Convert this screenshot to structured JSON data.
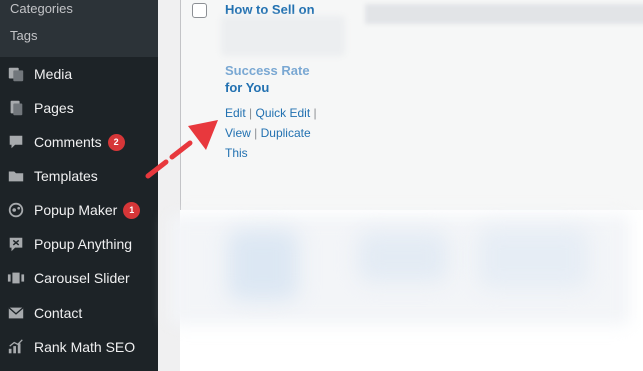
{
  "sidebar": {
    "submenu": [
      "Categories",
      "Tags"
    ],
    "items": [
      {
        "label": "Media",
        "icon": "media-icon"
      },
      {
        "label": "Pages",
        "icon": "pages-icon"
      },
      {
        "label": "Comments",
        "icon": "comments-icon",
        "badge": "2"
      },
      {
        "label": "Templates",
        "icon": "folder-icon"
      },
      {
        "label": "Popup Maker",
        "icon": "popup-maker-icon",
        "badge": "1"
      },
      {
        "label": "Popup Anything",
        "icon": "popup-anything-icon"
      },
      {
        "label": "Carousel Slider",
        "icon": "slider-icon"
      },
      {
        "label": "Contact",
        "icon": "mail-icon"
      },
      {
        "label": "Rank Math SEO",
        "icon": "chart-icon"
      }
    ]
  },
  "post": {
    "title_start": "How to Sell on",
    "title_end_faded": "Success Rate",
    "title_end": "for You",
    "actions": {
      "edit": "Edit",
      "quick_edit": "Quick Edit",
      "view": "View",
      "duplicate": "Duplicate This",
      "separator": "|"
    }
  },
  "colors": {
    "sidebar_bg": "#1d2327",
    "link": "#2271b1",
    "badge": "#d63638",
    "arrow": "#e8383d"
  }
}
